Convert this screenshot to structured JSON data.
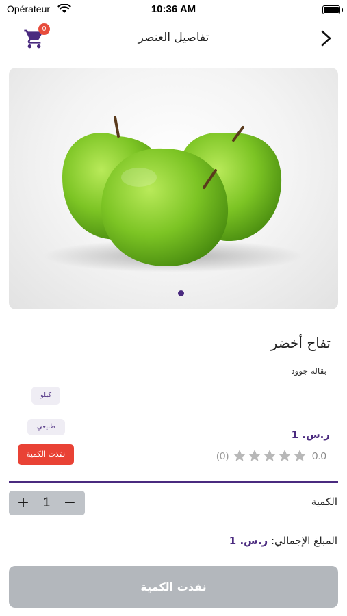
{
  "status_bar": {
    "carrier": "Opérateur",
    "time": "10:36 AM"
  },
  "nav": {
    "title": "تفاصيل العنصر",
    "cart_count": "0",
    "cart_icon": "cart-icon",
    "back_icon": "chevron-right-icon"
  },
  "gallery": {
    "page_count": 1,
    "current_page": 1
  },
  "product": {
    "name": "تفاح أخضر",
    "store": "بقالة جوود",
    "tags": [
      "كيلو",
      "طبيعي"
    ],
    "out_of_stock_badge": "نفذت الكمية",
    "price": "ر.س. 1",
    "rating_value": "0.0",
    "rating_count": "(0)",
    "stars": 5
  },
  "quantity": {
    "label": "الكمية",
    "value": "1",
    "plus": "+",
    "minus": "−"
  },
  "total": {
    "label": "المبلغ الإجمالي:",
    "value": "ر.س. 1"
  },
  "action_button": {
    "label": "نفذت الكمية"
  },
  "colors": {
    "accent": "#4a2a7f",
    "danger": "#e94235",
    "disabled": "#b3b7bc",
    "star": "#b8b8b8"
  }
}
